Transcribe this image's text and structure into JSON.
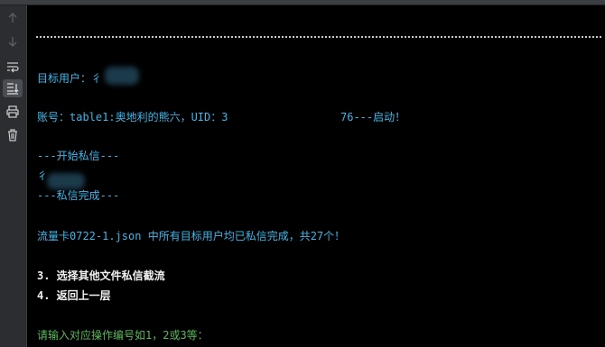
{
  "toolbar": {
    "items": [
      {
        "name": "scroll-up-icon"
      },
      {
        "name": "scroll-down-icon"
      },
      {
        "name": "soft-wrap-icon"
      },
      {
        "name": "scroll-to-end-icon",
        "active": true
      },
      {
        "name": "print-icon"
      },
      {
        "name": "trash-icon"
      }
    ]
  },
  "console": {
    "target_user": "目标用户：彳",
    "account_line_start": "账号：table1:奥地利的熊六，UID：3",
    "account_line_end": "76---启动！",
    "dm_start": "---开始私信---",
    "dm_user": "彳",
    "dm_done": "---私信完成---",
    "summary": "流量卡0722-1.json 中所有目标用户均已私信完成，共27个！",
    "option_3": "3. 选择其他文件私信截流",
    "option_4": "4. 返回上一层",
    "prompt": "请输入对应操作编号如1，2或3等："
  },
  "colors": {
    "cyan": "#3fb7ea",
    "white": "#f0f0f0",
    "green": "#5bb85b",
    "background": "#000000"
  }
}
